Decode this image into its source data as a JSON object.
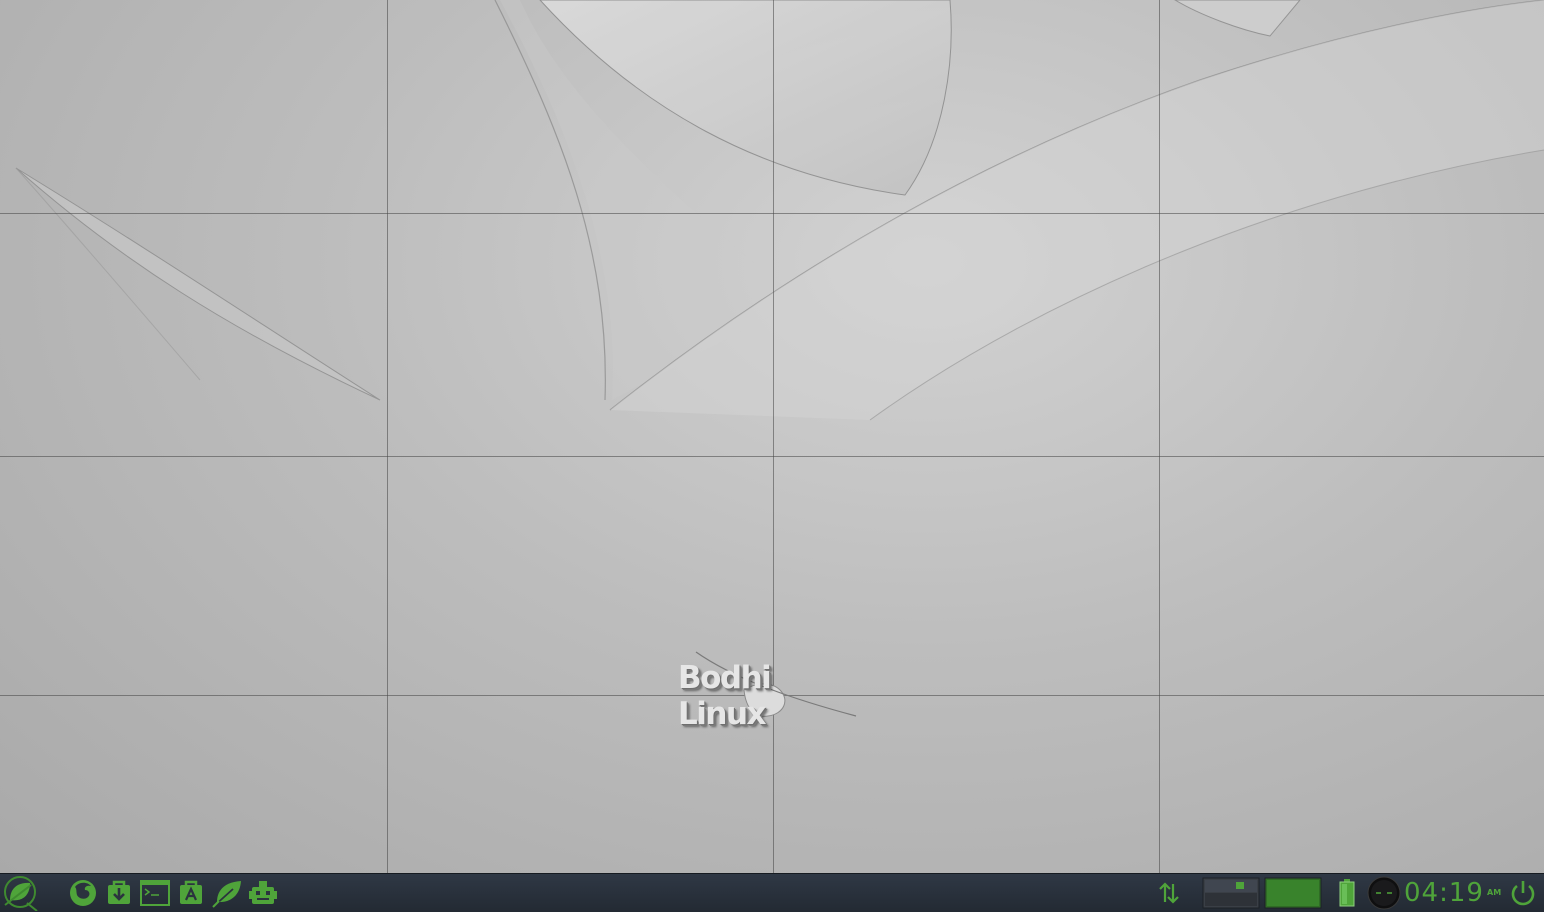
{
  "desktop": {
    "logo_text": "Bodhi Linux",
    "virtual_desktops": {
      "columns": 4,
      "rows": 4,
      "active": 1
    }
  },
  "taskbar": {
    "start_menu_icon": "bodhi-leaf-icon",
    "launchers": [
      {
        "icon": "firefox-icon"
      },
      {
        "icon": "package-install-icon"
      },
      {
        "icon": "terminal-icon"
      },
      {
        "icon": "app-center-icon"
      },
      {
        "icon": "leaf-icon"
      },
      {
        "icon": "settings-robot-icon"
      }
    ],
    "tray": {
      "network_icon": "network-updown-icon",
      "pager_icon": "desktop-pager-icon",
      "battery_icon": "battery-icon",
      "mixer_icon": "volume-mixer-icon",
      "clock": {
        "time": "04:19",
        "ampm": "AM"
      },
      "power_icon": "power-icon"
    }
  },
  "colors": {
    "accent": "#4fa43a",
    "taskbar_bg": "#2b333e",
    "wallpaper": "#bdbdbd"
  }
}
